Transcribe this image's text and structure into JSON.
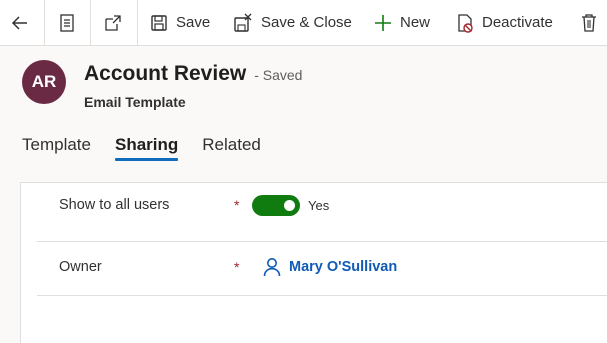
{
  "toolbar": {
    "back_label": "",
    "save_label": "Save",
    "save_close_label": "Save & Close",
    "new_label": "New",
    "deactivate_label": "Deactivate"
  },
  "record": {
    "initials": "AR",
    "title": "Account Review",
    "saved_status": "- Saved",
    "entity": "Email Template"
  },
  "tabs": [
    {
      "label": "Template",
      "active": false
    },
    {
      "label": "Sharing",
      "active": true
    },
    {
      "label": "Related",
      "active": false
    }
  ],
  "form": {
    "show_all": {
      "label": "Show to all users",
      "required_mark": "*",
      "value": "Yes",
      "toggle_on": true
    },
    "owner": {
      "label": "Owner",
      "required_mark": "*",
      "value": "Mary O'Sullivan"
    }
  },
  "colors": {
    "accent": "#0f6cbd",
    "toggle": "#107c10",
    "avatar": "#6b2a44",
    "required": "#a4262c"
  }
}
